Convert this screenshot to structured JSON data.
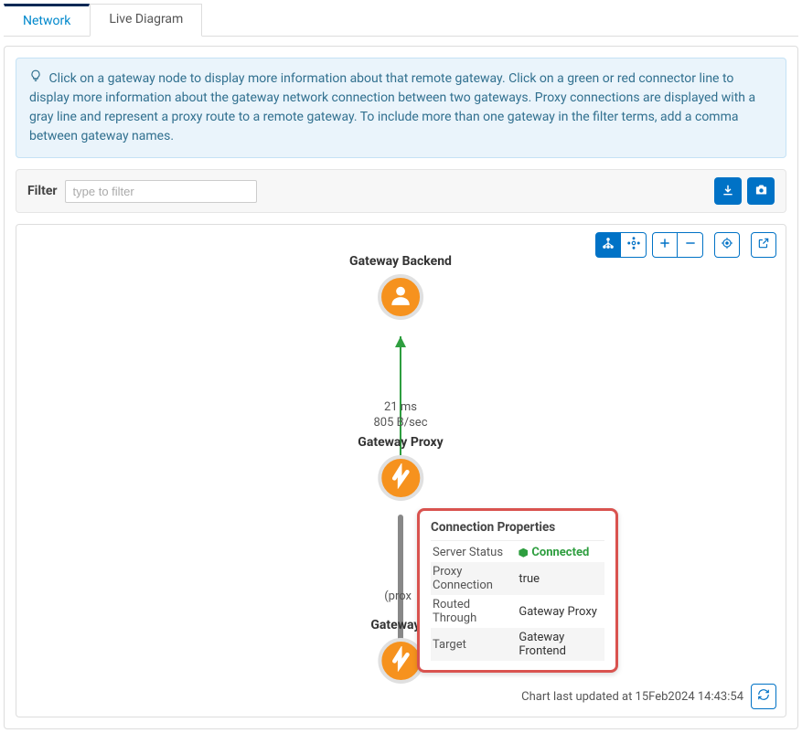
{
  "tabs": {
    "network": "Network",
    "live": "Live Diagram"
  },
  "info_text": "Click on a gateway node to display more information about that remote gateway. Click on a green or red connector line to display more information about the gateway network connection between two gateways. Proxy connections are displayed with a gray line and represent a proxy route to a remote gateway. To include more than one gateway in the filter terms, add a comma between gateway names.",
  "filter": {
    "label": "Filter",
    "placeholder": "type to filter"
  },
  "nodes": {
    "n1": "Gateway Backend",
    "n2": "Gateway Proxy",
    "n3_partial": "Gateway F",
    "edge1_line1": "21 ms",
    "edge1_line2": "805 B/sec",
    "proxy_label": "(prox"
  },
  "popup": {
    "title": "Connection Properties",
    "rows": {
      "server_status_key": "Server Status",
      "server_status_val": "Connected",
      "proxy_conn_key": "Proxy Connection",
      "proxy_conn_val": "true",
      "routed_key": "Routed Through",
      "routed_val": "Gateway Proxy",
      "target_key": "Target",
      "target_val": "Gateway Frontend"
    }
  },
  "footer": {
    "text": "Chart last updated at 15Feb2024 14:43:54"
  }
}
